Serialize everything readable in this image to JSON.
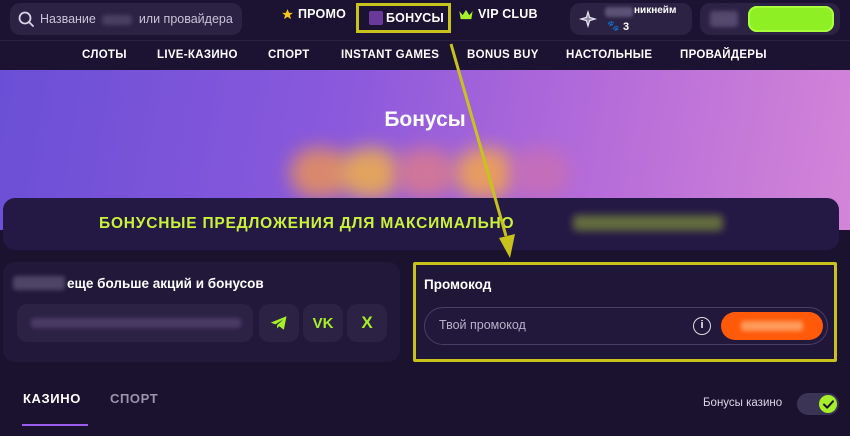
{
  "colors": {
    "background": "#1b1230",
    "accent_green": "#a6ef2a",
    "accent_yellow": "#c9f23b",
    "orange": "#ff5a0a",
    "highlight_box": "#c8c31c"
  },
  "header": {
    "search_placeholder_start": "Название",
    "search_placeholder_end": "или провайдера",
    "nav": {
      "promo": "ПРОМО",
      "bonuses": "БОНУСЫ",
      "vip": "VIP CLUB"
    },
    "user": {
      "nickname": "никнейм",
      "count": "3"
    }
  },
  "categories": [
    "СЛОТЫ",
    "LIVE-КАЗИНО",
    "СПОРТ",
    "INSTANT GAMES",
    "BONUS BUY",
    "НАСТОЛЬНЫЕ",
    "ПРОВАЙДЕРЫ"
  ],
  "hero": {
    "title": "Бонусы",
    "banner_text": "БОНУСНЫЕ ПРЕДЛОЖЕНИЯ ДЛЯ МАКСИМАЛЬНО"
  },
  "social": {
    "title": "еще больше акций и бонусов",
    "vk_label": "VK",
    "x_label": "X"
  },
  "promocode": {
    "label": "Промокод",
    "placeholder": "Твой промокод",
    "info_symbol": "i"
  },
  "tabs": {
    "casino": "КАЗИНО",
    "sport": "СПОРТ"
  },
  "toggle": {
    "label": "Бонусы казино",
    "on": true
  }
}
